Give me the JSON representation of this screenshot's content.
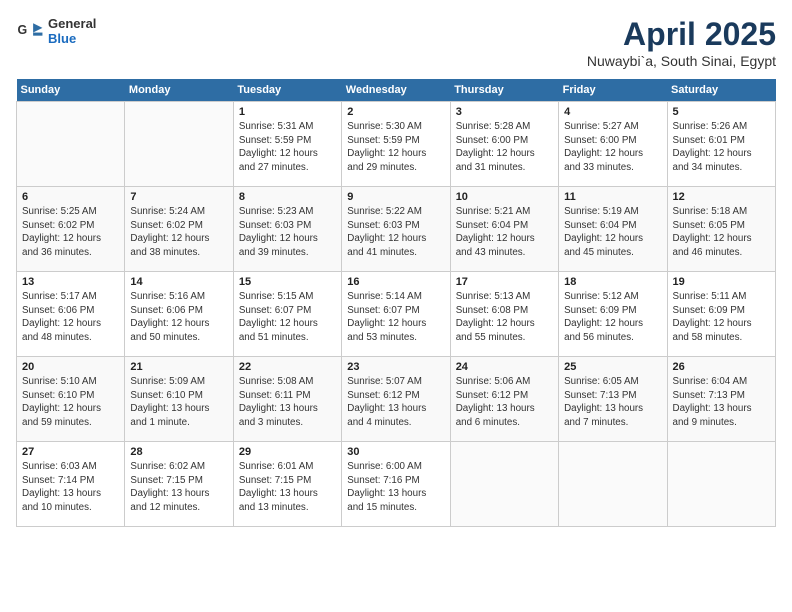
{
  "logo": {
    "general": "General",
    "blue": "Blue"
  },
  "title": "April 2025",
  "location": "Nuwaybi`a, South Sinai, Egypt",
  "weekdays": [
    "Sunday",
    "Monday",
    "Tuesday",
    "Wednesday",
    "Thursday",
    "Friday",
    "Saturday"
  ],
  "weeks": [
    [
      {
        "day": "",
        "info": ""
      },
      {
        "day": "",
        "info": ""
      },
      {
        "day": "1",
        "info": "Sunrise: 5:31 AM\nSunset: 5:59 PM\nDaylight: 12 hours and 27 minutes."
      },
      {
        "day": "2",
        "info": "Sunrise: 5:30 AM\nSunset: 5:59 PM\nDaylight: 12 hours and 29 minutes."
      },
      {
        "day": "3",
        "info": "Sunrise: 5:28 AM\nSunset: 6:00 PM\nDaylight: 12 hours and 31 minutes."
      },
      {
        "day": "4",
        "info": "Sunrise: 5:27 AM\nSunset: 6:00 PM\nDaylight: 12 hours and 33 minutes."
      },
      {
        "day": "5",
        "info": "Sunrise: 5:26 AM\nSunset: 6:01 PM\nDaylight: 12 hours and 34 minutes."
      }
    ],
    [
      {
        "day": "6",
        "info": "Sunrise: 5:25 AM\nSunset: 6:02 PM\nDaylight: 12 hours and 36 minutes."
      },
      {
        "day": "7",
        "info": "Sunrise: 5:24 AM\nSunset: 6:02 PM\nDaylight: 12 hours and 38 minutes."
      },
      {
        "day": "8",
        "info": "Sunrise: 5:23 AM\nSunset: 6:03 PM\nDaylight: 12 hours and 39 minutes."
      },
      {
        "day": "9",
        "info": "Sunrise: 5:22 AM\nSunset: 6:03 PM\nDaylight: 12 hours and 41 minutes."
      },
      {
        "day": "10",
        "info": "Sunrise: 5:21 AM\nSunset: 6:04 PM\nDaylight: 12 hours and 43 minutes."
      },
      {
        "day": "11",
        "info": "Sunrise: 5:19 AM\nSunset: 6:04 PM\nDaylight: 12 hours and 45 minutes."
      },
      {
        "day": "12",
        "info": "Sunrise: 5:18 AM\nSunset: 6:05 PM\nDaylight: 12 hours and 46 minutes."
      }
    ],
    [
      {
        "day": "13",
        "info": "Sunrise: 5:17 AM\nSunset: 6:06 PM\nDaylight: 12 hours and 48 minutes."
      },
      {
        "day": "14",
        "info": "Sunrise: 5:16 AM\nSunset: 6:06 PM\nDaylight: 12 hours and 50 minutes."
      },
      {
        "day": "15",
        "info": "Sunrise: 5:15 AM\nSunset: 6:07 PM\nDaylight: 12 hours and 51 minutes."
      },
      {
        "day": "16",
        "info": "Sunrise: 5:14 AM\nSunset: 6:07 PM\nDaylight: 12 hours and 53 minutes."
      },
      {
        "day": "17",
        "info": "Sunrise: 5:13 AM\nSunset: 6:08 PM\nDaylight: 12 hours and 55 minutes."
      },
      {
        "day": "18",
        "info": "Sunrise: 5:12 AM\nSunset: 6:09 PM\nDaylight: 12 hours and 56 minutes."
      },
      {
        "day": "19",
        "info": "Sunrise: 5:11 AM\nSunset: 6:09 PM\nDaylight: 12 hours and 58 minutes."
      }
    ],
    [
      {
        "day": "20",
        "info": "Sunrise: 5:10 AM\nSunset: 6:10 PM\nDaylight: 12 hours and 59 minutes."
      },
      {
        "day": "21",
        "info": "Sunrise: 5:09 AM\nSunset: 6:10 PM\nDaylight: 13 hours and 1 minute."
      },
      {
        "day": "22",
        "info": "Sunrise: 5:08 AM\nSunset: 6:11 PM\nDaylight: 13 hours and 3 minutes."
      },
      {
        "day": "23",
        "info": "Sunrise: 5:07 AM\nSunset: 6:12 PM\nDaylight: 13 hours and 4 minutes."
      },
      {
        "day": "24",
        "info": "Sunrise: 5:06 AM\nSunset: 6:12 PM\nDaylight: 13 hours and 6 minutes."
      },
      {
        "day": "25",
        "info": "Sunrise: 6:05 AM\nSunset: 7:13 PM\nDaylight: 13 hours and 7 minutes."
      },
      {
        "day": "26",
        "info": "Sunrise: 6:04 AM\nSunset: 7:13 PM\nDaylight: 13 hours and 9 minutes."
      }
    ],
    [
      {
        "day": "27",
        "info": "Sunrise: 6:03 AM\nSunset: 7:14 PM\nDaylight: 13 hours and 10 minutes."
      },
      {
        "day": "28",
        "info": "Sunrise: 6:02 AM\nSunset: 7:15 PM\nDaylight: 13 hours and 12 minutes."
      },
      {
        "day": "29",
        "info": "Sunrise: 6:01 AM\nSunset: 7:15 PM\nDaylight: 13 hours and 13 minutes."
      },
      {
        "day": "30",
        "info": "Sunrise: 6:00 AM\nSunset: 7:16 PM\nDaylight: 13 hours and 15 minutes."
      },
      {
        "day": "",
        "info": ""
      },
      {
        "day": "",
        "info": ""
      },
      {
        "day": "",
        "info": ""
      }
    ]
  ]
}
